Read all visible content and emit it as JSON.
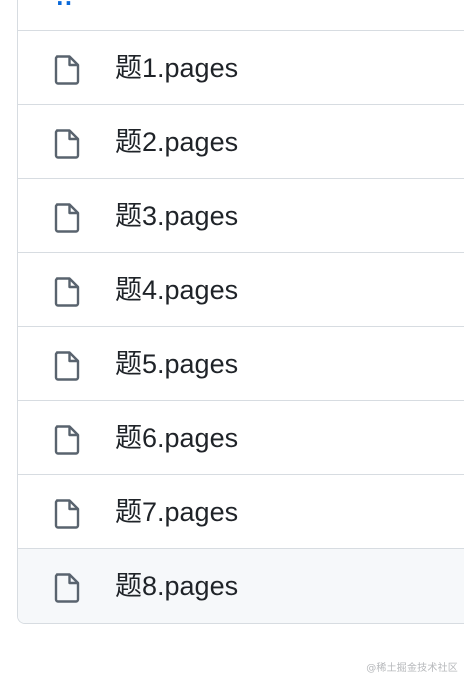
{
  "file_list": {
    "parent_link": "··",
    "files": [
      {
        "name": "题1.pages",
        "icon": "file-icon"
      },
      {
        "name": "题2.pages",
        "icon": "file-icon"
      },
      {
        "name": "题3.pages",
        "icon": "file-icon"
      },
      {
        "name": "题4.pages",
        "icon": "file-icon"
      },
      {
        "name": "题5.pages",
        "icon": "file-icon"
      },
      {
        "name": "题6.pages",
        "icon": "file-icon"
      },
      {
        "name": "题7.pages",
        "icon": "file-icon"
      },
      {
        "name": "题8.pages",
        "icon": "file-icon"
      }
    ]
  },
  "watermark": "@稀土掘金技术社区",
  "colors": {
    "text": "#1f2328",
    "icon": "#59636e",
    "border": "#d7dce1",
    "link": "#0969da",
    "hover_bg": "#f6f8fa"
  }
}
